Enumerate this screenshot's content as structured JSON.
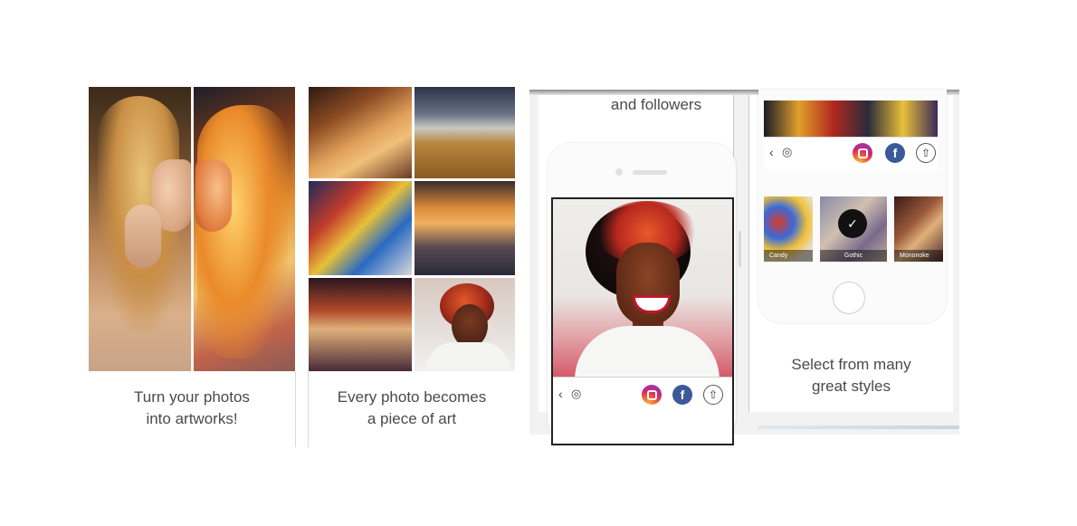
{
  "panels": [
    {
      "caption_line1": "Turn your photos",
      "caption_line2": "into artworks!"
    },
    {
      "caption_line1": "Every photo becomes",
      "caption_line2": "a piece of art"
    }
  ],
  "phone_screen_a": {
    "top_caption": "and followers",
    "toolbar": {
      "back_icon": "‹",
      "camera_icon": "◎",
      "facebook_letter": "f",
      "share_icon": "⇧"
    }
  },
  "phone_screen_b": {
    "styles": [
      {
        "name": "Candy"
      },
      {
        "name": "Gothic",
        "selected": true
      },
      {
        "name": "Mononoke"
      }
    ],
    "check_icon": "✓",
    "caption_line1": "Select from many",
    "caption_line2": "great styles",
    "toolbar": {
      "back_icon": "‹",
      "camera_icon": "◎",
      "facebook_letter": "f",
      "share_icon": "⇧"
    }
  },
  "colors": {
    "facebook": "#3b5998",
    "caption_text": "#4a4a4a"
  }
}
